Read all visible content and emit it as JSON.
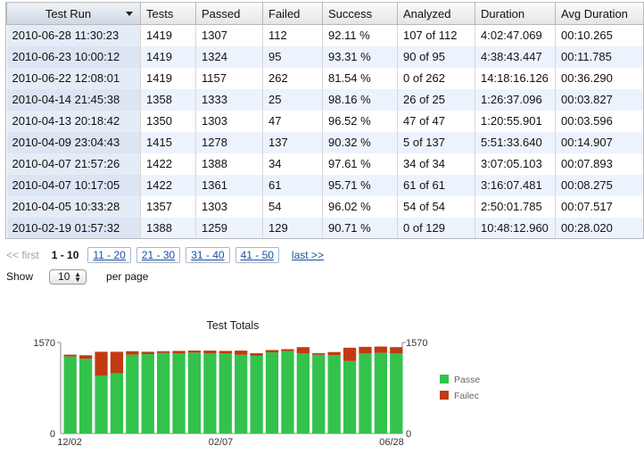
{
  "table": {
    "columns": [
      "Test Run",
      "Tests",
      "Passed",
      "Failed",
      "Success",
      "Analyzed",
      "Duration",
      "Avg Duration"
    ],
    "rows": [
      [
        "2010-06-28 11:30:23",
        "1419",
        "1307",
        "112",
        "92.11 %",
        "107 of 112",
        "4:02:47.069",
        "00:10.265"
      ],
      [
        "2010-06-23 10:00:12",
        "1419",
        "1324",
        "95",
        "93.31 %",
        "90 of 95",
        "4:38:43.447",
        "00:11.785"
      ],
      [
        "2010-06-22 12:08:01",
        "1419",
        "1157",
        "262",
        "81.54 %",
        "0 of 262",
        "14:18:16.126",
        "00:36.290"
      ],
      [
        "2010-04-14 21:45:38",
        "1358",
        "1333",
        "25",
        "98.16 %",
        "26 of 25",
        "1:26:37.096",
        "00:03.827"
      ],
      [
        "2010-04-13 20:18:42",
        "1350",
        "1303",
        "47",
        "96.52 %",
        "47 of 47",
        "1:20:55.901",
        "00:03.596"
      ],
      [
        "2010-04-09 23:04:43",
        "1415",
        "1278",
        "137",
        "90.32 %",
        "5 of 137",
        "5:51:33.640",
        "00:14.907"
      ],
      [
        "2010-04-07 21:57:26",
        "1422",
        "1388",
        "34",
        "97.61 %",
        "34 of 34",
        "3:07:05.103",
        "00:07.893"
      ],
      [
        "2010-04-07 10:17:05",
        "1422",
        "1361",
        "61",
        "95.71 %",
        "61 of 61",
        "3:16:07.481",
        "00:08.275"
      ],
      [
        "2010-04-05 10:33:28",
        "1357",
        "1303",
        "54",
        "96.02 %",
        "54 of 54",
        "2:50:01.785",
        "00:07.517"
      ],
      [
        "2010-02-19 01:57:32",
        "1388",
        "1259",
        "129",
        "90.71 %",
        "0 of 129",
        "10:48:12.960",
        "00:28.020"
      ]
    ]
  },
  "pager": {
    "first": "<< first",
    "current": "1 - 10",
    "pages": [
      "11 - 20",
      "21 - 30",
      "31 - 40",
      "41 - 50"
    ],
    "last": "last >>"
  },
  "show": {
    "label": "Show",
    "value": "10",
    "suffix": "per page"
  },
  "chart_data": {
    "type": "bar",
    "stacked": true,
    "title": "Test Totals",
    "ylim": [
      0,
      1570
    ],
    "y_ticks_left": [
      "1570",
      "0"
    ],
    "y_ticks_right": [
      "1570",
      "0"
    ],
    "x_tick_labels": [
      "12/02",
      "02/07",
      "06/28"
    ],
    "series": [
      {
        "name": "Passed",
        "color": "#33c24c",
        "values": [
          1330,
          1290,
          1000,
          1040,
          1360,
          1370,
          1390,
          1385,
          1395,
          1380,
          1385,
          1360,
          1340,
          1400,
          1420,
          1380,
          1360,
          1350,
          1250,
          1380,
          1390,
          1380
        ]
      },
      {
        "name": "Failed",
        "color": "#c23a10",
        "values": [
          30,
          60,
          410,
          370,
          60,
          40,
          30,
          40,
          35,
          50,
          40,
          70,
          45,
          40,
          35,
          110,
          25,
          55,
          230,
          115,
          110,
          110
        ]
      }
    ],
    "legend": [
      "Passe",
      "Failec"
    ],
    "legend_position": "right"
  }
}
